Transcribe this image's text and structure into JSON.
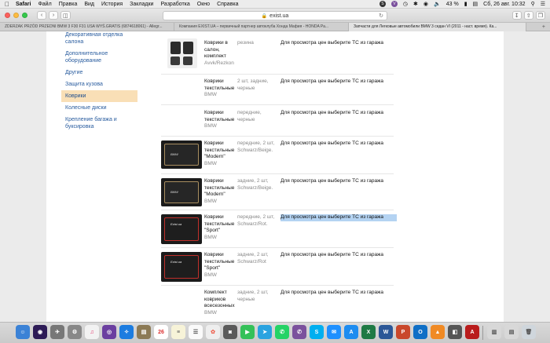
{
  "menubar": {
    "items": [
      "Safari",
      "Файл",
      "Правка",
      "Вид",
      "История",
      "Закладки",
      "Разработка",
      "Окно",
      "Справка"
    ],
    "battery": "43 %",
    "clock": "Сб, 26 авг.  10:32"
  },
  "browser": {
    "address": "exist.ua",
    "tabs": [
      "ZDERZAK PRZÓD PRZEDNI BMW 3 F30 F31 USA WYŚ.GRATIS (6874618061) - Allegr...",
      "Компания EXIST.UA – первичный партнер автоклуба Хонда Мафия - HONDA Ра...",
      "Запчасти для Легковые автомобили BMW 3 седан VI (2011 - наст. время). Ка..."
    ],
    "active_tab": 2
  },
  "sidebar": {
    "items": [
      "Декоративная отделка салона",
      "Дополнительное оборудование",
      "Другие",
      "Защита кузова",
      "Коврики",
      "Колесные диски",
      "Крепление багажа и буксировка"
    ],
    "active_index": 4
  },
  "products": [
    {
      "name": "Коврики в салон, комплект",
      "brand": "Avvk/Rezkon",
      "desc": "резина",
      "price": "Для просмотра цен выберите ТС из гаража"
    },
    {
      "name": "Коврики текстильные",
      "brand": "BMW",
      "desc": "2 шт, задние, черные",
      "price": "Для просмотра цен выберите ТС из гаража"
    },
    {
      "name": "Коврики текстильные",
      "brand": "BMW",
      "desc": "передние, черные",
      "price": "Для просмотра цен выберите ТС из гаража"
    },
    {
      "name": "Коврики текстильные \"Modern\"",
      "brand": "BMW",
      "desc": "передние, 2 шт, Schwarz/Beige.",
      "price": "Для просмотра цен выберите ТС из гаража"
    },
    {
      "name": "Коврики текстильные \"Modern\"",
      "brand": "BMW",
      "desc": "задние, 2 шт, Schwarz/Beige.",
      "price": "Для просмотра цен выберите ТС из гаража"
    },
    {
      "name": "Коврики текстильные \"Sport\"",
      "brand": "BMW",
      "desc": "передние, 2 шт, Schwarz/Rot.",
      "price": "Для просмотра цен выберите ТС из гаража"
    },
    {
      "name": "Коврики текстильные \"Sport\"",
      "brand": "BMW",
      "desc": "задние, 2 шт, Schwarz/Rot",
      "price": "Для просмотра цен выберите ТС из гаража"
    },
    {
      "name": "Комплект ковриков всесезонных",
      "brand": "BMW",
      "desc": "задние, 2 шт, черные",
      "price": "Для просмотра цен выберите ТС из гаража"
    }
  ],
  "colors": {
    "link": "#2a5d9f",
    "active_category_bg": "#f9dfb6",
    "selection": "#b4d3f2"
  }
}
